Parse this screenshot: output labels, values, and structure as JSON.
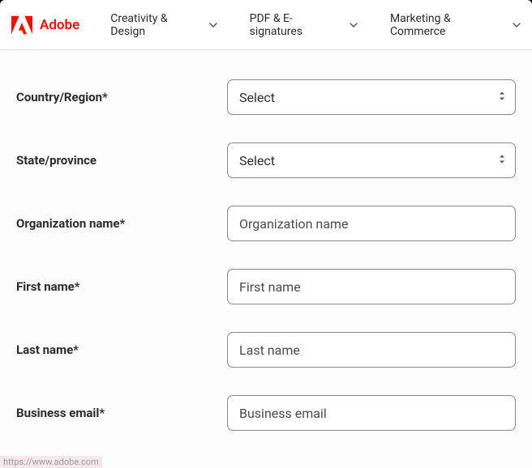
{
  "brand": {
    "name": "Adobe",
    "color": "#eb1000"
  },
  "nav": {
    "items": [
      {
        "label": "Creativity & Design"
      },
      {
        "label": "PDF & E-signatures"
      },
      {
        "label": "Marketing & Commerce"
      }
    ]
  },
  "form": {
    "country": {
      "label": "Country/Region*",
      "selected": "Select"
    },
    "state": {
      "label": "State/province",
      "selected": "Select"
    },
    "organization": {
      "label": "Organization name*",
      "placeholder": "Organization name",
      "value": ""
    },
    "first_name": {
      "label": "First name*",
      "placeholder": "First name",
      "value": ""
    },
    "last_name": {
      "label": "Last name*",
      "placeholder": "Last name",
      "value": ""
    },
    "business_email": {
      "label": "Business email*",
      "placeholder": "Business email",
      "value": ""
    }
  },
  "status": {
    "url": "https://www.adobe.com"
  }
}
